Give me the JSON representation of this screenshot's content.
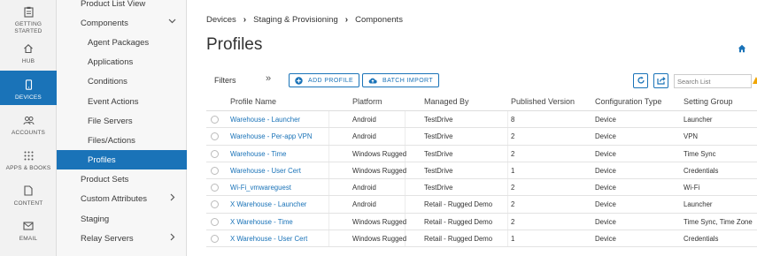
{
  "rail": {
    "items": [
      {
        "label": "GETTING STARTED",
        "icon": "clipboard-icon"
      },
      {
        "label": "HUB",
        "icon": "home-icon"
      },
      {
        "label": "DEVICES",
        "icon": "phone-icon",
        "active": true
      },
      {
        "label": "ACCOUNTS",
        "icon": "users-icon"
      },
      {
        "label": "APPS & BOOKS",
        "icon": "grid-icon"
      },
      {
        "label": "CONTENT",
        "icon": "document-icon"
      },
      {
        "label": "EMAIL",
        "icon": "envelope-icon"
      }
    ]
  },
  "subnav": {
    "items": [
      {
        "label": "Product List View"
      },
      {
        "label": "Components",
        "expanded": true
      },
      {
        "label": "Agent Packages"
      },
      {
        "label": "Applications"
      },
      {
        "label": "Conditions"
      },
      {
        "label": "Event Actions"
      },
      {
        "label": "File Servers"
      },
      {
        "label": "Files/Actions"
      },
      {
        "label": "Profiles",
        "active": true
      },
      {
        "label": "Product Sets"
      },
      {
        "label": "Custom Attributes"
      },
      {
        "label": "Staging"
      },
      {
        "label": "Relay Servers"
      }
    ]
  },
  "breadcrumb": [
    "Devices",
    "Staging & Provisioning",
    "Components"
  ],
  "page": {
    "title": "Profiles"
  },
  "toolbar": {
    "filters_label": "Filters",
    "add_profile_label": "ADD PROFILE",
    "batch_import_label": "BATCH IMPORT",
    "search_placeholder": "Search List"
  },
  "table": {
    "columns": [
      "Profile Name",
      "Platform",
      "Managed By",
      "Published Version",
      "Configuration Type",
      "Setting Group"
    ],
    "rows": [
      [
        "Warehouse - Launcher",
        "Android",
        "TestDrive",
        "8",
        "Device",
        "Launcher"
      ],
      [
        "Warehouse - Per-app VPN",
        "Android",
        "TestDrive",
        "2",
        "Device",
        "VPN"
      ],
      [
        "Warehouse - Time",
        "Windows Rugged",
        "TestDrive",
        "2",
        "Device",
        "Time Sync"
      ],
      [
        "Warehouse - User Cert",
        "Windows Rugged",
        "TestDrive",
        "1",
        "Device",
        "Credentials"
      ],
      [
        "Wi-Fi_vmwareguest",
        "Android",
        "TestDrive",
        "2",
        "Device",
        "Wi-Fi"
      ],
      [
        "X Warehouse - Launcher",
        "Android",
        "Retail - Rugged Demo",
        "2",
        "Device",
        "Launcher"
      ],
      [
        "X Warehouse - Time",
        "Windows Rugged",
        "Retail - Rugged Demo",
        "2",
        "Device",
        "Time Sync, Time Zone"
      ],
      [
        "X Warehouse - User Cert",
        "Windows Rugged",
        "Retail - Rugged Demo",
        "1",
        "Device",
        "Credentials"
      ]
    ]
  },
  "colors": {
    "accent": "#1a73b8",
    "warning": "#f0a500"
  }
}
